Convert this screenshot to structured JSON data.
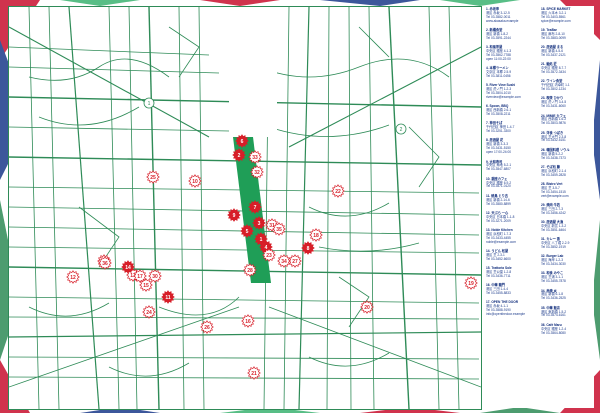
{
  "map": {
    "labels": {
      "a": "1",
      "b": "2"
    },
    "markers": [
      {
        "n": "1",
        "style": "filled"
      },
      {
        "n": "2",
        "style": "filled"
      },
      {
        "n": "3",
        "style": "filled"
      },
      {
        "n": "4",
        "style": "filled"
      },
      {
        "n": "5",
        "style": "filled"
      },
      {
        "n": "6",
        "style": "filled"
      },
      {
        "n": "7",
        "style": "filled"
      },
      {
        "n": "8",
        "style": "filled"
      },
      {
        "n": "9",
        "style": "filled"
      },
      {
        "n": "10",
        "style": "outline"
      },
      {
        "n": "11",
        "style": "filled"
      },
      {
        "n": "12",
        "style": "outline"
      },
      {
        "n": "13",
        "style": "outline"
      },
      {
        "n": "14",
        "style": "filled"
      },
      {
        "n": "15",
        "style": "outline"
      },
      {
        "n": "16",
        "style": "outline"
      },
      {
        "n": "17",
        "style": "outline"
      },
      {
        "n": "18",
        "style": "outline"
      },
      {
        "n": "19",
        "style": "outline"
      },
      {
        "n": "20",
        "style": "outline"
      },
      {
        "n": "21",
        "style": "outline"
      },
      {
        "n": "22",
        "style": "outline"
      },
      {
        "n": "23",
        "style": "outline"
      },
      {
        "n": "24",
        "style": "outline"
      },
      {
        "n": "25",
        "style": "outline"
      },
      {
        "n": "26",
        "style": "outline"
      },
      {
        "n": "27",
        "style": "outline"
      },
      {
        "n": "28",
        "style": "outline"
      },
      {
        "n": "29",
        "style": "outline"
      },
      {
        "n": "30",
        "style": "outline"
      },
      {
        "n": "31",
        "style": "outline"
      },
      {
        "n": "32",
        "style": "outline"
      },
      {
        "n": "33",
        "style": "outline"
      },
      {
        "n": "34",
        "style": "outline"
      },
      {
        "n": "35",
        "style": "outline"
      },
      {
        "n": "36",
        "style": "outline"
      }
    ]
  },
  "colors": {
    "road": "#2e8b57",
    "highlight": "#1f9e57",
    "marker_fill": "#d71e28",
    "marker_outline": "#d71e28",
    "legend_text": "#1b3a8a"
  },
  "legend": {
    "left": [
      {
        "name": "1. 赤坂亭",
        "lines": [
          "港区 赤坂 3-12-5",
          "Tel 03-3582-0011",
          "www.akasaka.example"
        ]
      },
      {
        "name": "2. 新橋食堂",
        "lines": [
          "港区 新橋 1-8-2",
          "Tel 03-3591-2244"
        ]
      },
      {
        "name": "3. 和風茶屋",
        "lines": [
          "中央区 銀座 4-1-3",
          "Tel 03-3562-7788",
          "open 11:00-22:00"
        ]
      },
      {
        "name": "4. 本郷ラーメン",
        "lines": [
          "文京区 本郷 2-5-9",
          "Tel 03-3811-0456"
        ]
      },
      {
        "name": "5. River View Sushi",
        "lines": [
          "港区 虎ノ門 1-2-3",
          "Tel 03-3504-1010",
          "riverview@example.com"
        ]
      },
      {
        "name": "6. Spoon, BBQ",
        "lines": [
          "港区 西新橋 2-6-1",
          "Tel 03-3508-2211"
        ]
      },
      {
        "name": "7. 神田そば",
        "lines": [
          "千代田区 神田 1-4-7",
          "Tel 03-3251-3300"
        ]
      },
      {
        "name": "8. 居酒屋 花",
        "lines": [
          "港区 新橋 3-3-3",
          "Tel 03-3431-5150",
          "open 17:00-24:00"
        ]
      },
      {
        "name": "9. 大和寿司",
        "lines": [
          "中央区 築地 5-2-1",
          "Tel 03-3547-6807"
        ]
      },
      {
        "name": "10. 銀座カフェ",
        "lines": [
          "中央区 銀座 6-9-2",
          "Tel 03-3571-0120"
        ]
      },
      {
        "name": "11. 焼鳥 とり吉",
        "lines": [
          "港区 新橋 2-14-6",
          "Tel 03-3580-8899"
        ]
      },
      {
        "name": "12. 天ぷら 一心",
        "lines": [
          "中央区 日本橋 1-1-8",
          "Tel 03-3271-2009"
        ]
      },
      {
        "name": "13. Noble Kitchen",
        "lines": [
          "港区 浜松町 1-7-3",
          "Tel 03-3433-4455",
          "noble@example.com"
        ]
      },
      {
        "name": "14. うどん 松屋",
        "lines": [
          "港区 芝 2-3-1",
          "Tel 03-3452-6600"
        ]
      },
      {
        "name": "15. Trattoria Sole",
        "lines": [
          "港区 芝公園 1-2-8",
          "Tel 03-3436-7711"
        ]
      },
      {
        "name": "16. 中華 龍門",
        "lines": [
          "港区 三田 1-4-4",
          "Tel 03-3455-8833"
        ]
      },
      {
        "name": "17. OPEN THE DOOR",
        "lines": [
          "港区 赤坂 4-1-1",
          "Tel 03-3588-9190",
          "info@openthedoor.example"
        ]
      }
    ],
    "right": [
      {
        "name": "18. SPICE MARKET",
        "lines": [
          "港区 六本木 3-2-1",
          "Tel 03-3403-5561",
          "spice@example.com"
        ]
      },
      {
        "name": "19. TeaBar",
        "lines": [
          "港区 麻布 2-8-10",
          "Tel 03-3583-0099"
        ]
      },
      {
        "name": "20. 居酒屋 まる",
        "lines": [
          "港区 新橋 4-5-6",
          "Tel 03-3437-2121"
        ]
      },
      {
        "name": "21. 鮨処 匠",
        "lines": [
          "中央区 銀座 8-7-7",
          "Tel 03-3572-3434"
        ]
      },
      {
        "name": "22. ワイン食堂",
        "lines": [
          "千代田区 内幸町 1-1",
          "Tel 03-3502-1234"
        ]
      },
      {
        "name": "23. 喫茶 ひかり",
        "lines": [
          "港区 虎ノ門 3-4-5",
          "Tel 03-3431-6060"
        ]
      },
      {
        "name": "24. MIMIE カフェ",
        "lines": [
          "港区 西新橋 1-6-2",
          "Tel 03-3503-9876"
        ]
      },
      {
        "name": "25. 洋食 つばき",
        "lines": [
          "港区 芝大門 2-3-8",
          "Tel 03-3432-5151"
        ]
      },
      {
        "name": "26. 韓国料理 ソウル",
        "lines": [
          "港区 新橋 5-2-2",
          "Tel 03-3438-7373"
        ]
      },
      {
        "name": "27. そば処 藤",
        "lines": [
          "港区 浜松町 2-1-4",
          "Tel 03-3459-2828"
        ]
      },
      {
        "name": "28. Bistro Vert",
        "lines": [
          "港区 芝 3-5-7",
          "Tel 03-3454-1515",
          "vert@example.com"
        ]
      },
      {
        "name": "29. 焼肉 牛若",
        "lines": [
          "港区 三田 2-7-3",
          "Tel 03-3456-4242"
        ]
      },
      {
        "name": "30. 居酒屋 大漁",
        "lines": [
          "中央区 新富 1-3-2",
          "Tel 03-3551-6464"
        ]
      },
      {
        "name": "31. カレー 香",
        "lines": [
          "中央区 八丁堀 2-2-9",
          "Tel 03-3552-1919"
        ]
      },
      {
        "name": "32. Burger Lab",
        "lines": [
          "港区 海岸 1-2-3",
          "Tel 03-3434-3030"
        ]
      },
      {
        "name": "33. 和食 みやこ",
        "lines": [
          "港区 芝浦 3-1-1",
          "Tel 03-3455-7878"
        ]
      },
      {
        "name": "34. 串焼 炎",
        "lines": [
          "港区 新橋 6-1-8",
          "Tel 03-3436-2525"
        ]
      },
      {
        "name": "35. 中華 飯店",
        "lines": [
          "港区 東新橋 1-5-2",
          "Tel 03-3574-6161"
        ]
      },
      {
        "name": "36. Café Maru",
        "lines": [
          "中央区 銀座 1-2-4",
          "Tel 03-3564-8080"
        ]
      }
    ]
  }
}
